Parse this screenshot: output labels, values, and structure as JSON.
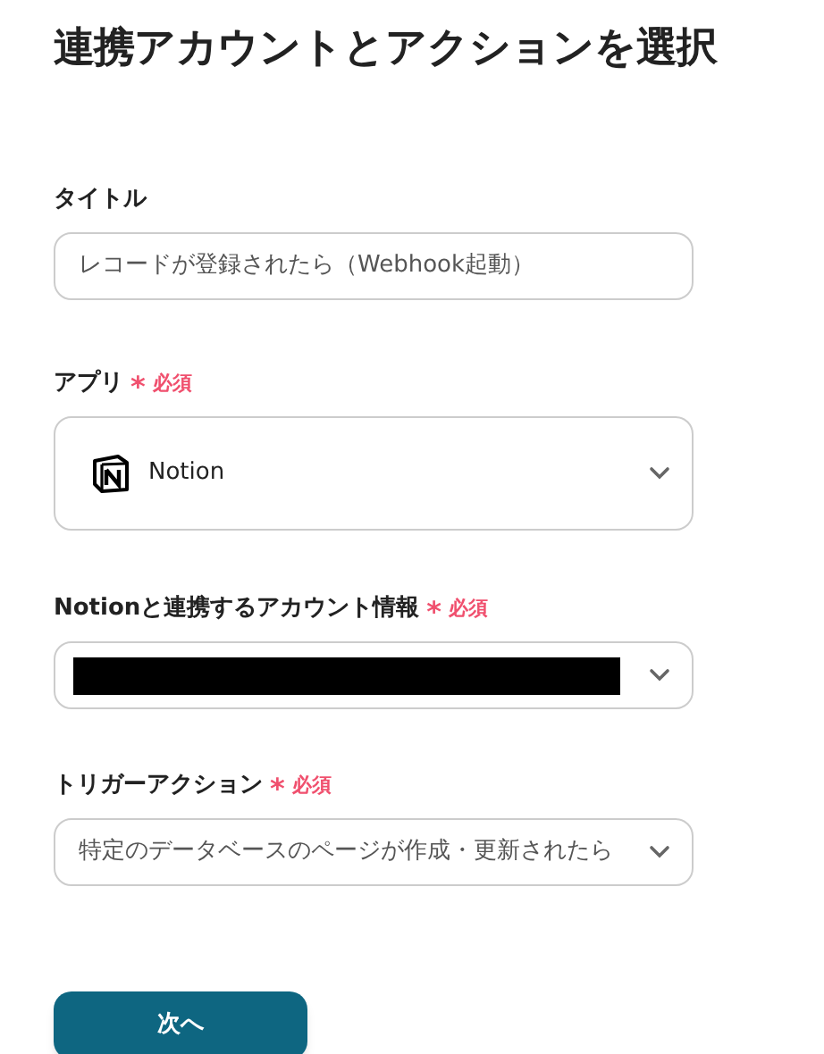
{
  "heading": "連携アカウントとアクションを選択",
  "fields": [
    {
      "kind": "text",
      "label": "タイトル",
      "value": "レコードが登録されたら（Webhook起動）"
    },
    {
      "kind": "app_select",
      "label": "アプリ",
      "required_mark": "*",
      "required_text": "必須",
      "value": "Notion"
    },
    {
      "kind": "redacted_select",
      "label": "Notionと連携するアカウント情報",
      "required_mark": "*",
      "required_text": "必須"
    },
    {
      "kind": "select",
      "label": "トリガーアクション",
      "required_mark": "*",
      "required_text": "必須",
      "value": "特定のデータベースのページが作成・更新されたら"
    }
  ],
  "next_button": "次へ"
}
